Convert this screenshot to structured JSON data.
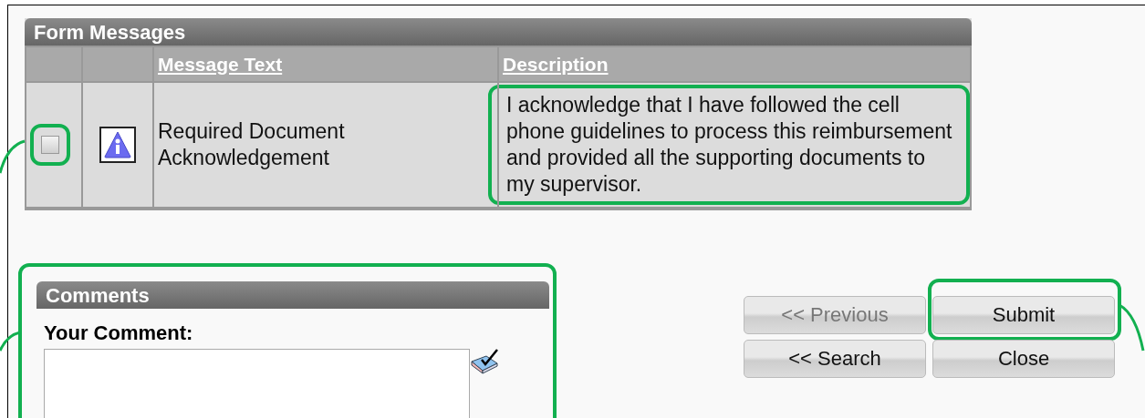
{
  "form_messages": {
    "title": "Form Messages",
    "columns": [
      {
        "label": "Message Text"
      },
      {
        "label": "Description"
      }
    ],
    "rows": [
      {
        "checked": false,
        "message_text": "Required Document Acknowledgement",
        "description": "I acknowledge that I have followed the cell phone guidelines to process this reimbursement and provided all the supporting documents to my supervisor."
      }
    ]
  },
  "comments": {
    "title": "Comments",
    "label": "Your Comment:"
  },
  "buttons": [
    {
      "label": "<< Previous",
      "disabled": true
    },
    {
      "label": "Submit",
      "disabled": false
    },
    {
      "label": "<< Search",
      "disabled": false
    },
    {
      "label": "Close",
      "disabled": false
    }
  ]
}
